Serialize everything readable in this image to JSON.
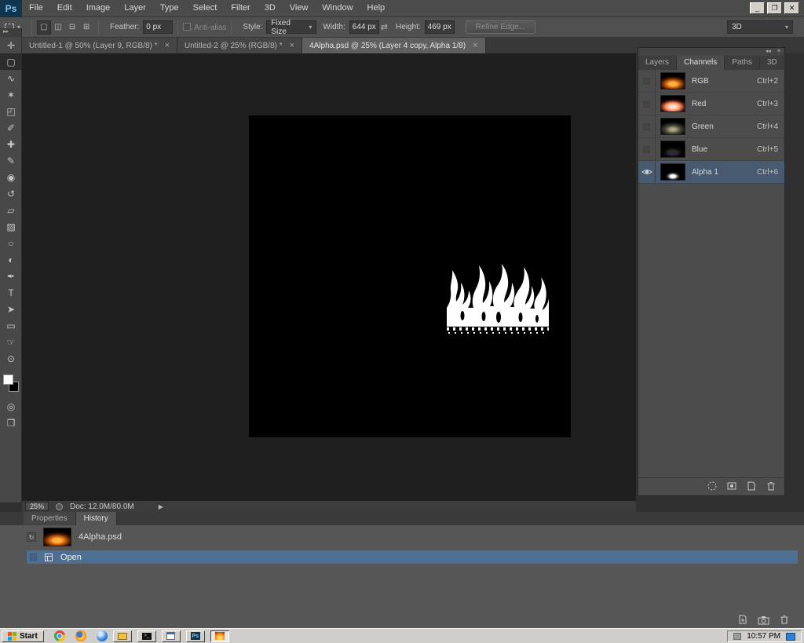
{
  "menu": {
    "logo": "Ps",
    "items": [
      "File",
      "Edit",
      "Image",
      "Layer",
      "Type",
      "Select",
      "Filter",
      "3D",
      "View",
      "Window",
      "Help"
    ]
  },
  "glyphs": {
    "close_tab": "×",
    "menu_arrow": "▾",
    "swap_dims": "⇄",
    "play": "▶",
    "collapse_left": "◂◂",
    "collapse_right": "▸▸",
    "panel_menu": "≡",
    "minimize": "_",
    "restore": "❐",
    "close_window": "✕",
    "quick_mask": "◎",
    "screen_mode": "❐",
    "history_source": "↻"
  },
  "options": {
    "modes": [
      {
        "name": "new-selection",
        "glyph": "▢"
      },
      {
        "name": "add-to-selection",
        "glyph": "◫"
      },
      {
        "name": "subtract-from-selection",
        "glyph": "⊟"
      },
      {
        "name": "intersect-selection",
        "glyph": "⊞"
      }
    ],
    "feather_label": "Feather:",
    "feather_value": "0 px",
    "antialias_label": "Anti-alias",
    "style_label": "Style:",
    "style_value": "Fixed Size",
    "width_label": "Width:",
    "width_value": "644 px",
    "height_label": "Height:",
    "height_value": "469 px",
    "refine_edge_label": "Refine Edge...",
    "workspace_value": "3D"
  },
  "toolbar": {
    "tools": [
      {
        "name": "move-tool",
        "glyph": "✛"
      },
      {
        "name": "rectangular-marquee-tool",
        "glyph": "▢"
      },
      {
        "name": "lasso-tool",
        "glyph": "∿"
      },
      {
        "name": "magic-wand-tool",
        "glyph": "✶"
      },
      {
        "name": "crop-tool",
        "glyph": "◰"
      },
      {
        "name": "eyedropper-tool",
        "glyph": "✐"
      },
      {
        "name": "healing-brush-tool",
        "glyph": "✚"
      },
      {
        "name": "brush-tool",
        "glyph": "✎"
      },
      {
        "name": "clone-stamp-tool",
        "glyph": "◉"
      },
      {
        "name": "history-brush-tool",
        "glyph": "↺"
      },
      {
        "name": "eraser-tool",
        "glyph": "▱"
      },
      {
        "name": "gradient-tool",
        "glyph": "▨"
      },
      {
        "name": "blur-tool",
        "glyph": "○"
      },
      {
        "name": "dodge-tool",
        "glyph": "◐"
      },
      {
        "name": "pen-tool",
        "glyph": "✒"
      },
      {
        "name": "type-tool",
        "glyph": "T"
      },
      {
        "name": "path-selection-tool",
        "glyph": "➤"
      },
      {
        "name": "rectangle-tool",
        "glyph": "▭"
      },
      {
        "name": "hand-tool",
        "glyph": "☞"
      },
      {
        "name": "zoom-tool",
        "glyph": "⊙"
      }
    ]
  },
  "doc_tabs": [
    {
      "label": "Untitled-1 @ 50% (Layer 9, RGB/8) *"
    },
    {
      "label": "Untitled-2 @ 25% (RGB/8) *"
    },
    {
      "label": "4Alpha.psd @ 25% (Layer 4 copy, Alpha 1/8)"
    }
  ],
  "channels": {
    "tabs": [
      "Layers",
      "Channels",
      "Paths",
      "3D"
    ],
    "active_tab": "Channels",
    "rows": [
      {
        "name": "RGB",
        "shortcut": "Ctrl+2"
      },
      {
        "name": "Red",
        "shortcut": "Ctrl+3"
      },
      {
        "name": "Green",
        "shortcut": "Ctrl+4"
      },
      {
        "name": "Blue",
        "shortcut": "Ctrl+5"
      },
      {
        "name": "Alpha 1",
        "shortcut": "Ctrl+6"
      }
    ],
    "selected_row": "Alpha 1"
  },
  "status": {
    "zoom": "25%",
    "doc_info": "Doc: 12.0M/80.0M"
  },
  "history": {
    "tabs": [
      "Properties",
      "History"
    ],
    "active_tab": "History",
    "snapshot_label": "4Alpha.psd",
    "states": [
      {
        "label": "Open"
      }
    ]
  },
  "taskbar": {
    "start_label": "Start",
    "time": "10:57 PM"
  },
  "colors": {
    "channel_selected_bg": "#475a70",
    "history_selected_bg": "#4e6f94",
    "canvas_bg": "#000000",
    "flame": "#ffffff",
    "logo_bg": "#11344f",
    "logo_text": "#8cc1ef"
  }
}
